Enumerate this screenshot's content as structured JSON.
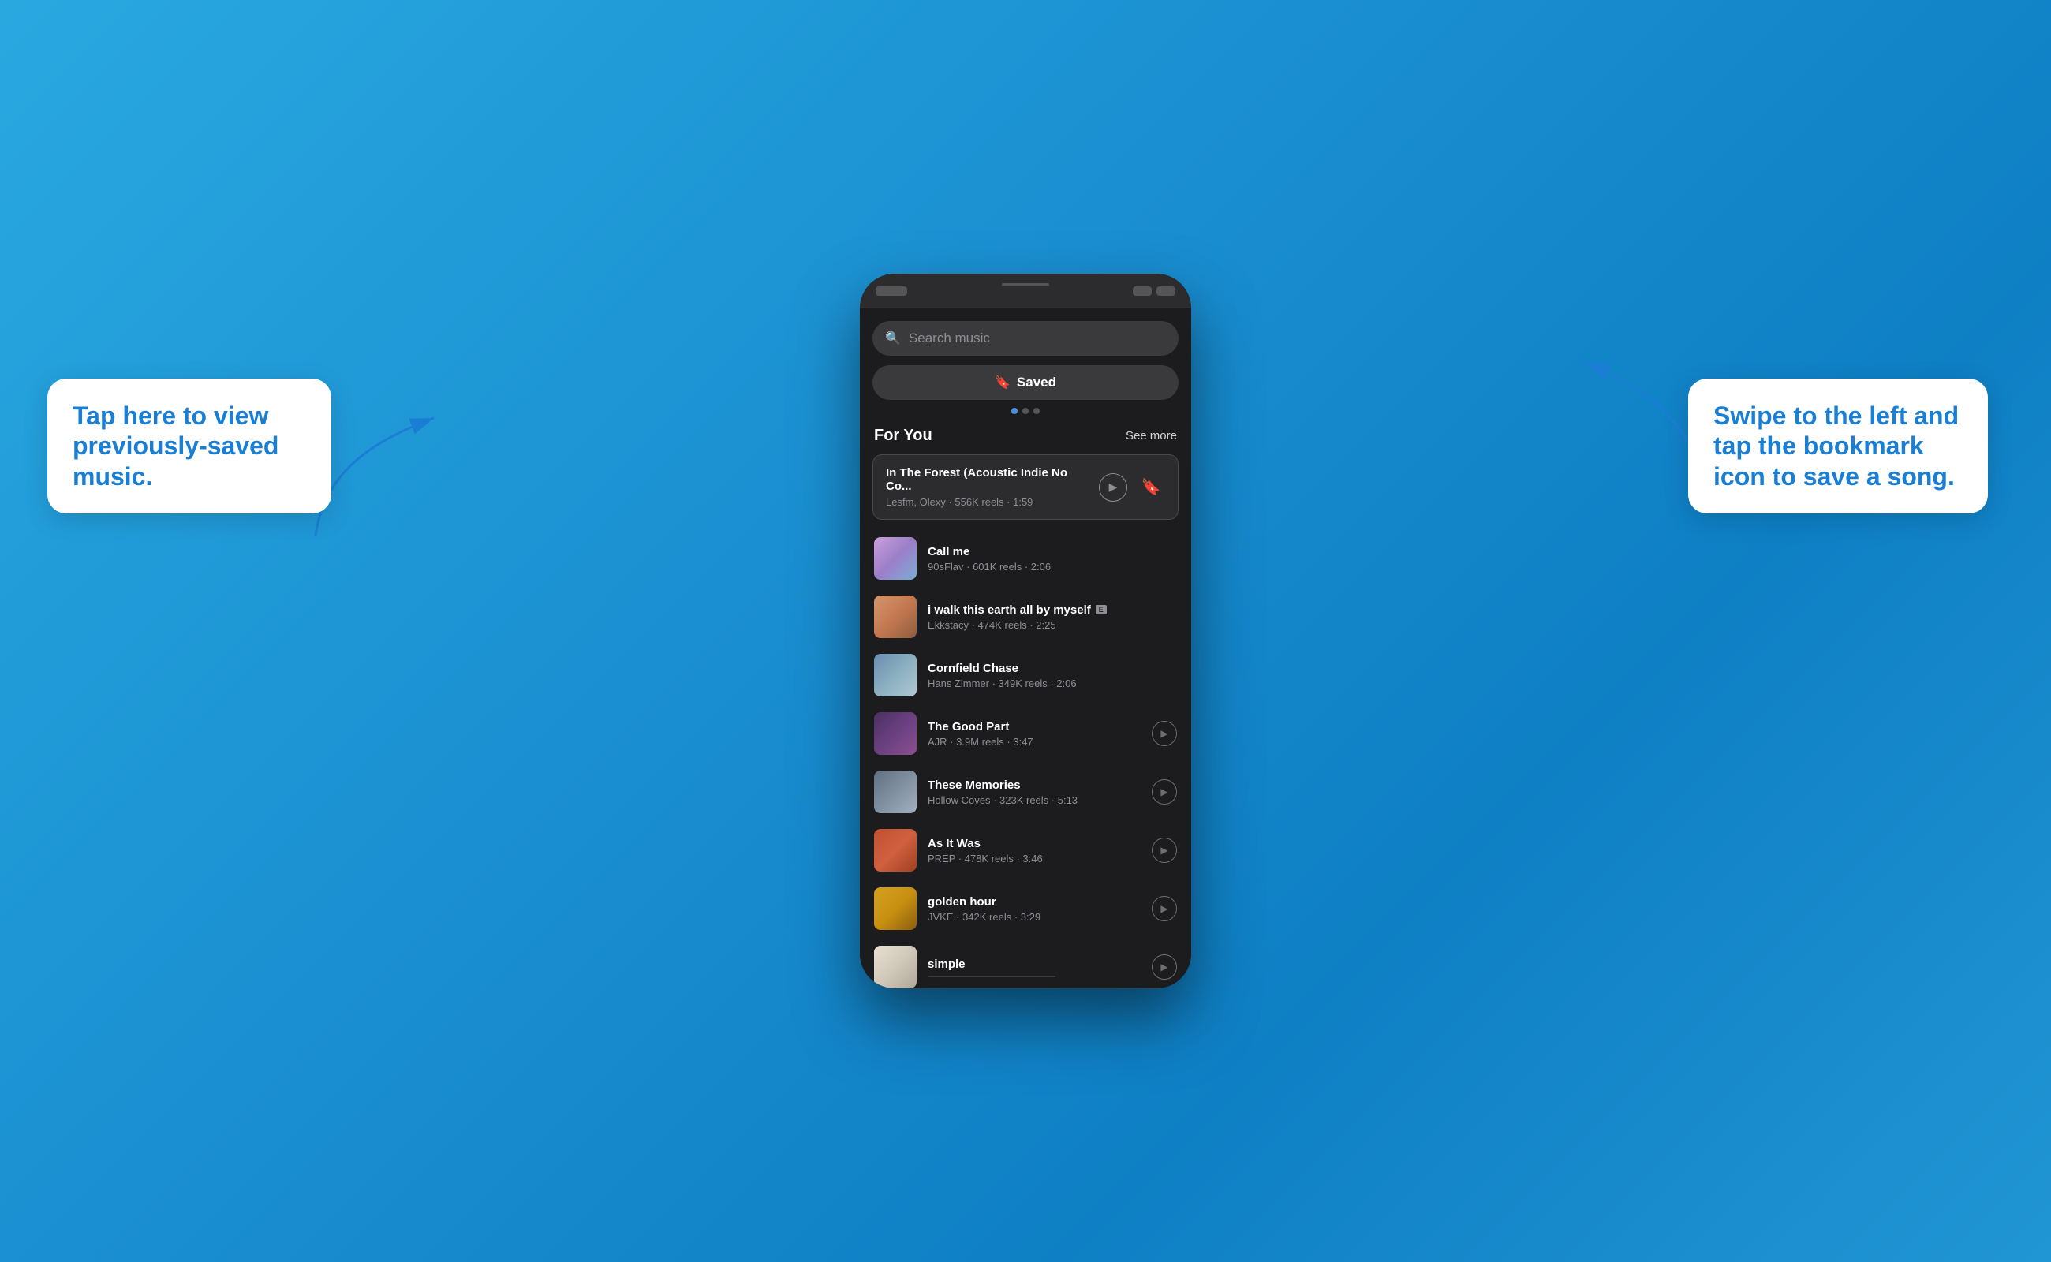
{
  "background": {
    "gradient_start": "#29a8e0",
    "gradient_end": "#0e7fc4"
  },
  "phone": {
    "search": {
      "placeholder": "Search music"
    },
    "saved_button": {
      "label": "Saved"
    },
    "page_dots": [
      true,
      false,
      false
    ],
    "for_you": {
      "title": "For You",
      "see_more": "See more"
    },
    "featured_track": {
      "name": "In The Forest (Acoustic Indie No Co...",
      "meta": "Lesfm, Olexy · 556K reels · 1:59"
    },
    "tracks": [
      {
        "name": "Call me",
        "artist": "90sFlav",
        "reels": "601K reels",
        "duration": "2:06",
        "explicit": false,
        "art_class": "art-call-me",
        "emoji": "🎵"
      },
      {
        "name": "i walk this earth all by myself",
        "artist": "Ekkstacy",
        "reels": "474K reels",
        "duration": "2:25",
        "explicit": true,
        "art_class": "art-walk",
        "emoji": "🎵"
      },
      {
        "name": "Cornfield Chase",
        "artist": "Hans Zimmer",
        "reels": "349K reels",
        "duration": "2:06",
        "explicit": false,
        "art_class": "art-cornfield",
        "emoji": "🎵"
      },
      {
        "name": "The Good Part",
        "artist": "AJR",
        "reels": "3.9M reels",
        "duration": "3:47",
        "explicit": false,
        "art_class": "art-good-part",
        "emoji": "🎵"
      },
      {
        "name": "These Memories",
        "artist": "Hollow Coves",
        "reels": "323K reels",
        "duration": "5:13",
        "explicit": false,
        "art_class": "art-memories",
        "emoji": "🎵"
      },
      {
        "name": "As It Was",
        "artist": "PREP",
        "reels": "478K reels",
        "duration": "3:46",
        "explicit": false,
        "art_class": "art-as-it-was",
        "emoji": "🎵"
      },
      {
        "name": "golden hour",
        "artist": "JVKE",
        "reels": "342K reels",
        "duration": "3:29",
        "explicit": false,
        "art_class": "art-golden-hour",
        "emoji": "🎵"
      },
      {
        "name": "simple",
        "artist": "",
        "reels": "",
        "duration": "",
        "explicit": false,
        "art_class": "art-simple",
        "emoji": "🎵"
      }
    ]
  },
  "callout_left": {
    "text": "Tap here to view previously-saved music."
  },
  "callout_right": {
    "text": "Swipe to the left and tap the bookmark icon to save a song."
  }
}
